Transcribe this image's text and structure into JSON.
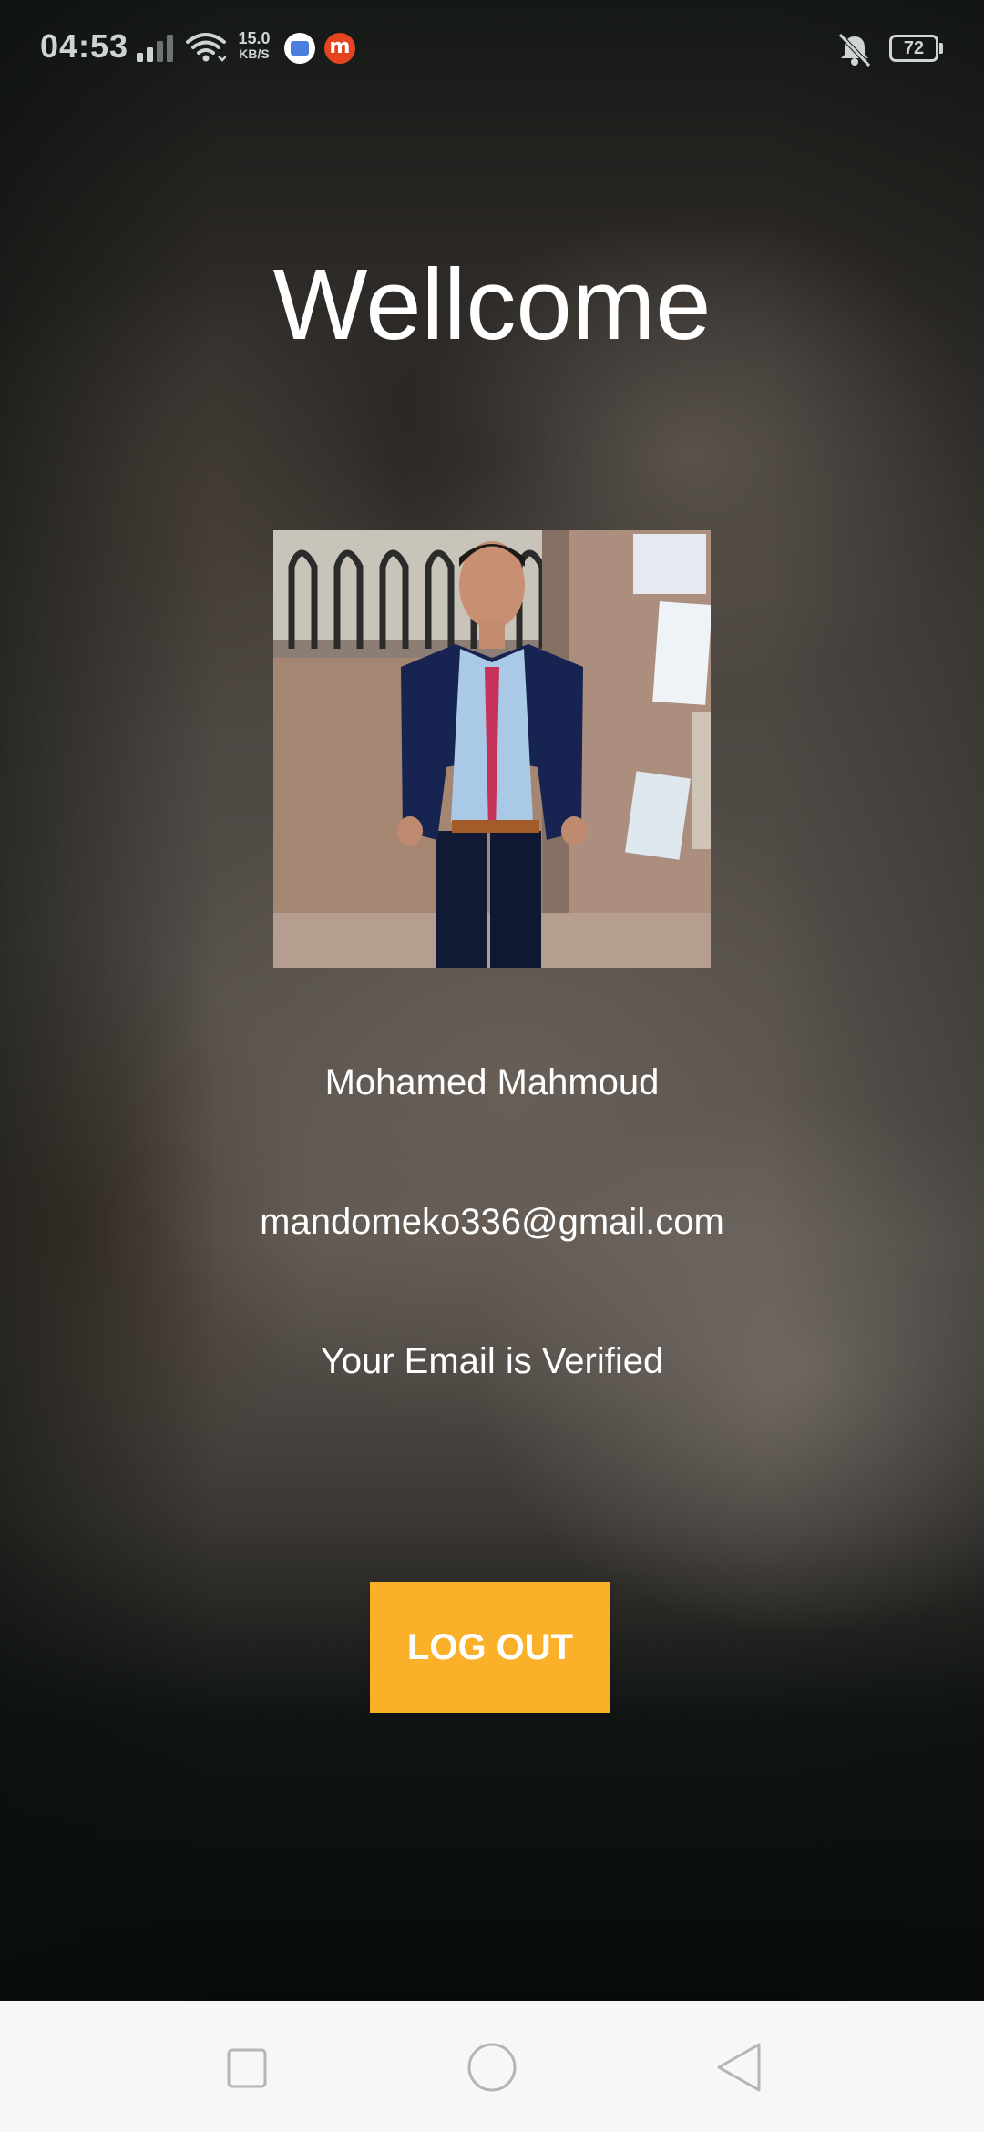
{
  "status_bar": {
    "time": "04:53",
    "net_speed_value": "15.0",
    "net_speed_unit": "KB/S",
    "battery_level": "72",
    "icons": [
      "signal-icon",
      "wifi-icon",
      "app-notification-icon",
      "m-app-icon",
      "vibrate-off-icon",
      "battery-icon"
    ]
  },
  "main": {
    "title": "Wellcome",
    "profile_photo": "profile-photo",
    "user_name": "Mohamed Mahmoud",
    "user_email": "mandomeko336@gmail.com",
    "verification_status": "Your Email is Verified",
    "logout_label": "LOG OUT"
  },
  "colors": {
    "accent_button": "#fbb02a",
    "text": "#ffffff",
    "nav_bar": "#f7f7f7"
  },
  "nav_bar": {
    "buttons": [
      "recents-button",
      "home-button",
      "back-button"
    ]
  }
}
